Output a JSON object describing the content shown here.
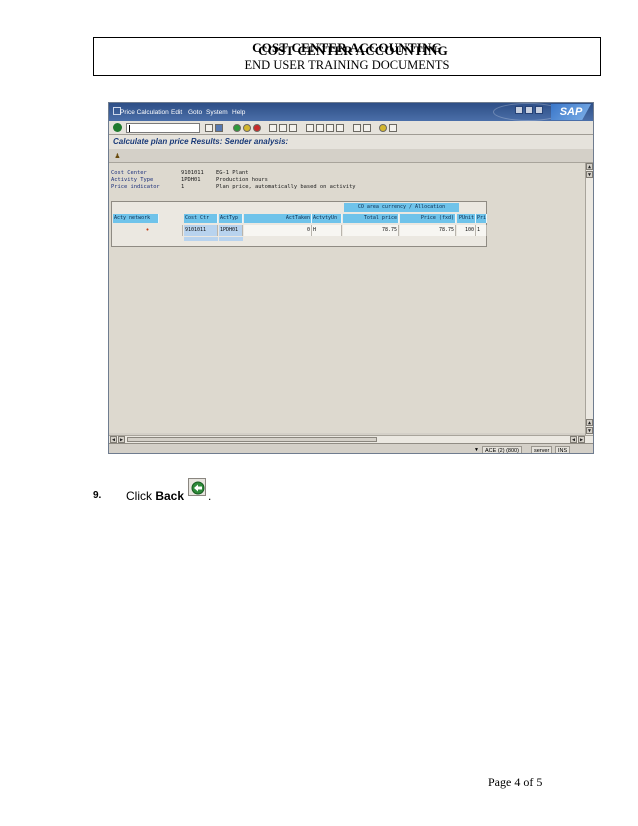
{
  "document": {
    "title": "COST CENTER ACCOUNTING",
    "subtitle": "END USER TRAINING DOCUMENTS",
    "page_label": "Page 4 of 5"
  },
  "sap": {
    "menu": [
      "Price Calculation",
      "Edit",
      "Goto",
      "System",
      "Help"
    ],
    "logo": "SAP",
    "screen_title": "Calculate plan price Results: Sender analysis:",
    "info": [
      {
        "label": "Cost Center",
        "value": "9101011",
        "desc": "EG-1 Plant"
      },
      {
        "label": "Activity Type",
        "value": "1PDH01",
        "desc": "Production hours"
      },
      {
        "label": "Price indicator",
        "value": "1",
        "desc": "Plan price, automatically based on activity"
      }
    ],
    "grid": {
      "group_header": "CO area currency / Allocation",
      "columns": [
        "Acty network",
        "Cost Ctr",
        "ActTyp",
        "ActTaken",
        "ActvtyUn",
        "Total price",
        "Price (fxd)",
        "PUnit",
        "Pri"
      ],
      "row": {
        "network": "•",
        "cost_ctr": "9101011",
        "act_typ": "1PDH01",
        "act_taken": "0",
        "unit": "H",
        "total_price": "78.75",
        "price_fixed": "78.75",
        "p_unit": "100",
        "pri": "1"
      }
    },
    "status": {
      "system": "ACE (2) (800)",
      "server": "server",
      "mode": "INS"
    }
  },
  "step": {
    "number": "9.",
    "text": "Click",
    "bold": "Back",
    "period": ".",
    "icon": "back-icon"
  },
  "colors": {
    "sap_header": "#2d4e86",
    "grid_header": "#6fc3ea",
    "selection": "#b8d3ee"
  }
}
